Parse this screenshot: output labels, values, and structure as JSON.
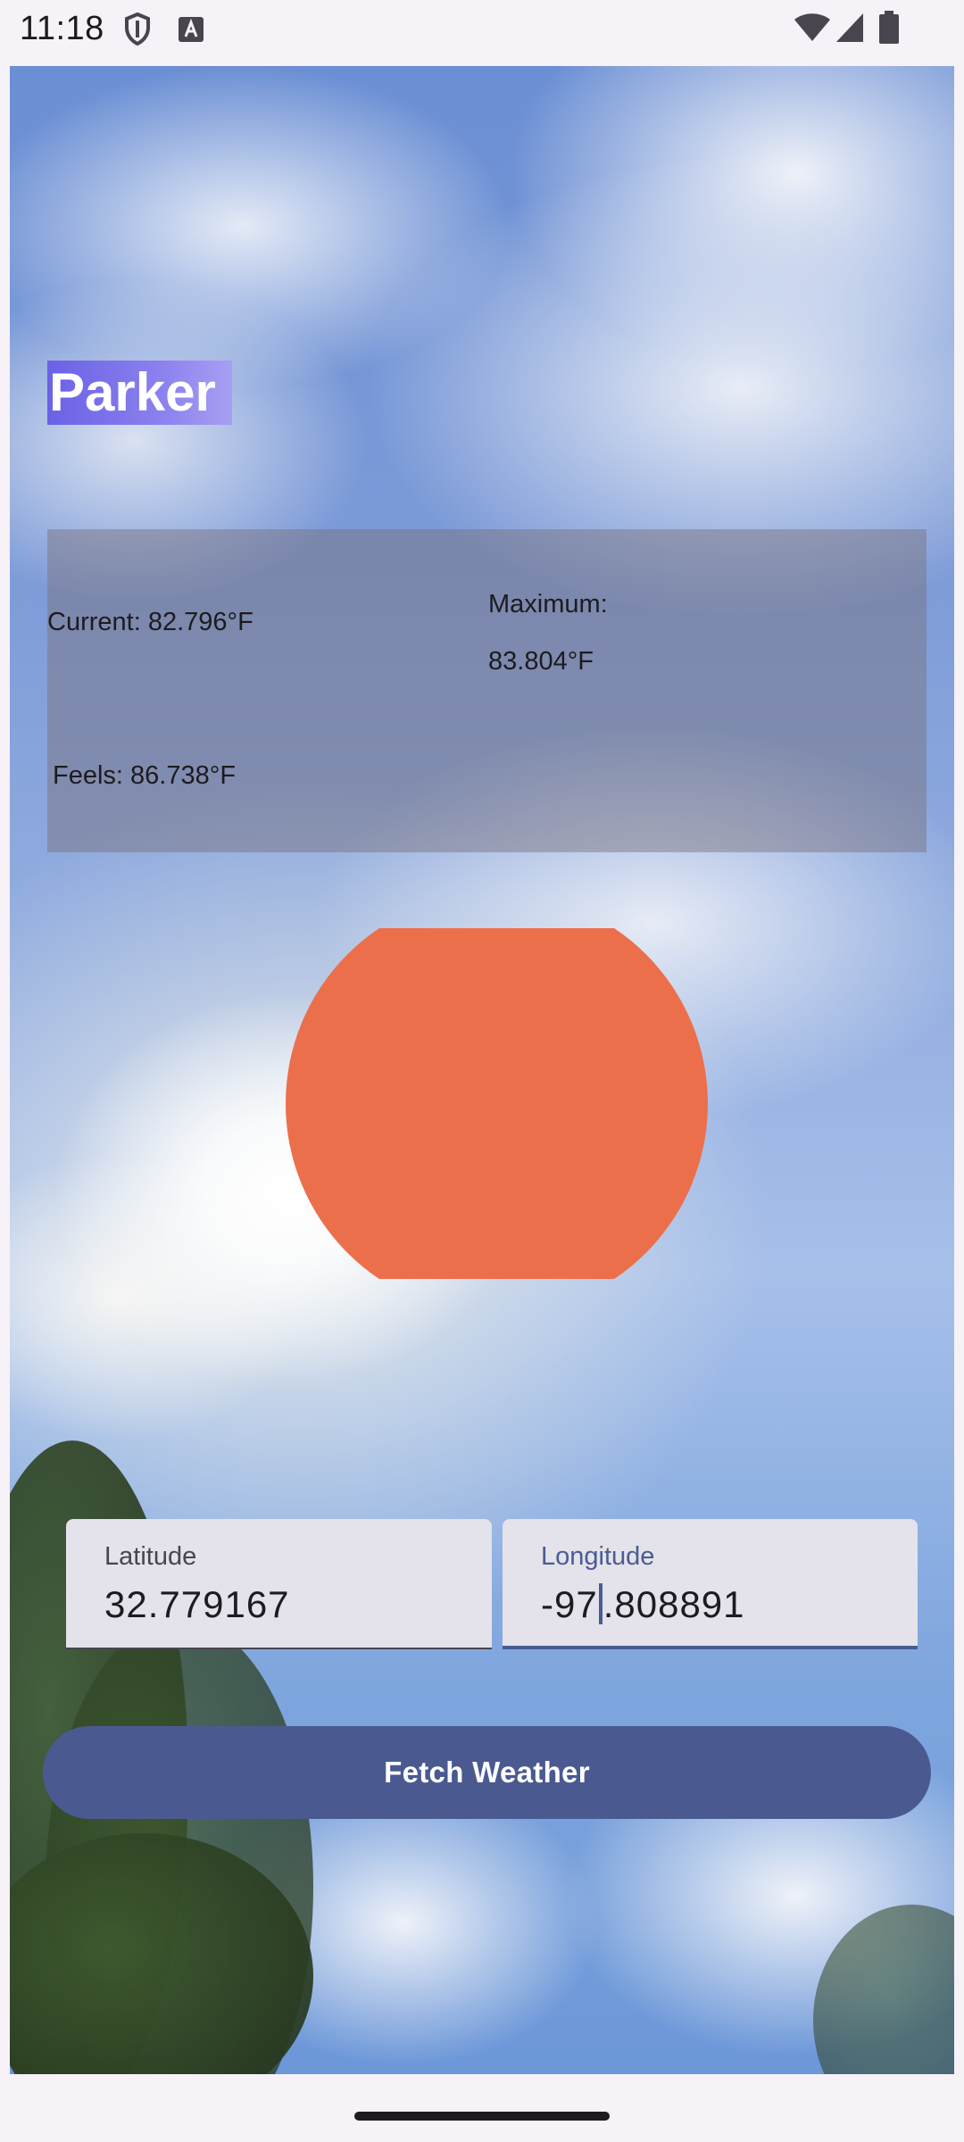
{
  "status_bar": {
    "time": "11:18",
    "icons": [
      "shield-icon",
      "text-a-icon",
      "wifi-icon",
      "signal-icon",
      "battery-icon"
    ]
  },
  "city": {
    "name": "Parker",
    "highlight_color": "#6a62e6"
  },
  "weather": {
    "current": "Current: 82.796°F",
    "maximum_label": "Maximum:",
    "maximum_value": "83.804°F",
    "feels": "Feels: 86.738°F",
    "icon": "sun-disc-icon",
    "icon_color": "#ec6f4b"
  },
  "inputs": {
    "latitude": {
      "label": "Latitude",
      "value": "32.779167"
    },
    "longitude": {
      "label": "Longitude",
      "value_before_cursor": "-97",
      "value_after_cursor": ".808891"
    }
  },
  "actions": {
    "fetch_label": "Fetch Weather",
    "button_color": "#4a5a91"
  }
}
